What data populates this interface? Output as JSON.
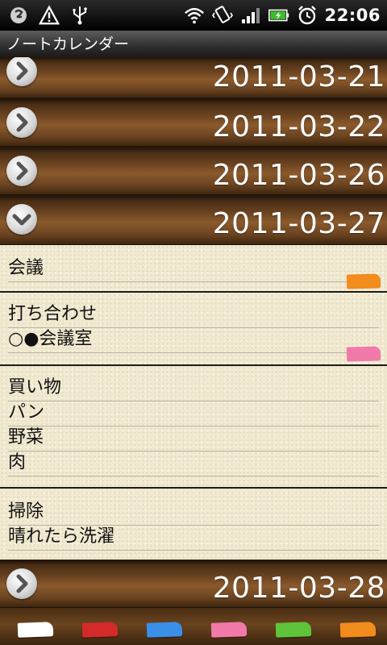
{
  "status_bar": {
    "time": "22:06",
    "icons": [
      "app-notification-icon",
      "warning-icon",
      "usb-icon",
      "wifi-icon",
      "vibrate-icon",
      "signal-icon",
      "battery-charging-icon",
      "alarm-icon"
    ]
  },
  "app": {
    "title": "ノートカレンダー"
  },
  "dates": [
    {
      "label": "2011-03-21",
      "state": "collapsed"
    },
    {
      "label": "2011-03-22",
      "state": "collapsed"
    },
    {
      "label": "2011-03-26",
      "state": "collapsed"
    },
    {
      "label": "2011-03-27",
      "state": "expanded"
    },
    {
      "label": "2011-03-28",
      "state": "collapsed"
    }
  ],
  "notes": [
    {
      "lines": [
        "会議"
      ],
      "tag_color": "#f28c1c"
    },
    {
      "lines": [
        "打ち合わせ",
        "○●会議室"
      ],
      "tag_color": "#f27aaa"
    },
    {
      "lines": [
        "買い物",
        "パン",
        "野菜",
        "肉"
      ],
      "tag_color": ""
    },
    {
      "lines": [
        "掃除",
        "晴れたら洗濯"
      ],
      "tag_color": ""
    }
  ],
  "palette": {
    "colors": [
      "#ffffff",
      "#d42a2a",
      "#3a8fe8",
      "#f27aaa",
      "#5fc43a",
      "#f28c1c"
    ]
  }
}
